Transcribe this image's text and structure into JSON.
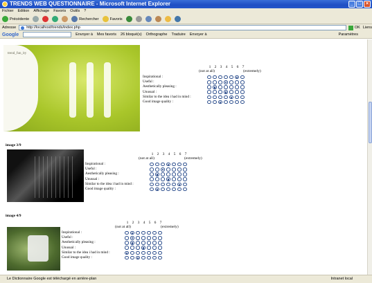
{
  "window": {
    "title": "TRENDS WEB QUESTIONNAIRE - Microsoft Internet Explorer"
  },
  "menu": [
    "Fichier",
    "Edition",
    "Affichage",
    "Favoris",
    "Outils",
    "?"
  ],
  "toolbar": {
    "back": "Précédente",
    "search": "Rechercher",
    "favorites": "Favoris"
  },
  "address": {
    "label": "Adresse",
    "url": "http://localhost/trends/index.php",
    "go": "OK",
    "links": "Liens"
  },
  "google": {
    "logo": "Google",
    "items": [
      "Envoyer à",
      "Mes favoris",
      "26 bloqué(s)",
      "Orthographe",
      "Traduire",
      "Envoyer à"
    ],
    "params": "Paramètres"
  },
  "scale": {
    "numbers": [
      "1",
      "2",
      "3",
      "4",
      "5",
      "6",
      "7"
    ],
    "low": "(not at all)",
    "high": "(extremely)"
  },
  "criteria": [
    "Inspirational :",
    "Useful :",
    "Aesthetically pleasing :",
    "Unusual :",
    "Similar to the idea i had in mind :",
    "Good image quality :"
  ],
  "images": [
    {
      "label": "",
      "selected": [
        6,
        4,
        2,
        4,
        5,
        3
      ]
    },
    {
      "label": "image 3/9",
      "selected": [
        4,
        3,
        2,
        4,
        6,
        2
      ]
    },
    {
      "label": "image 4/9",
      "selected": [
        2,
        2,
        2,
        4,
        1,
        3
      ]
    }
  ],
  "image1_caption": "trend_fun_ity",
  "status": {
    "text": "Le Dictionnaire Google est téléchargé en arrière-plan",
    "zone": "Intranet local"
  }
}
